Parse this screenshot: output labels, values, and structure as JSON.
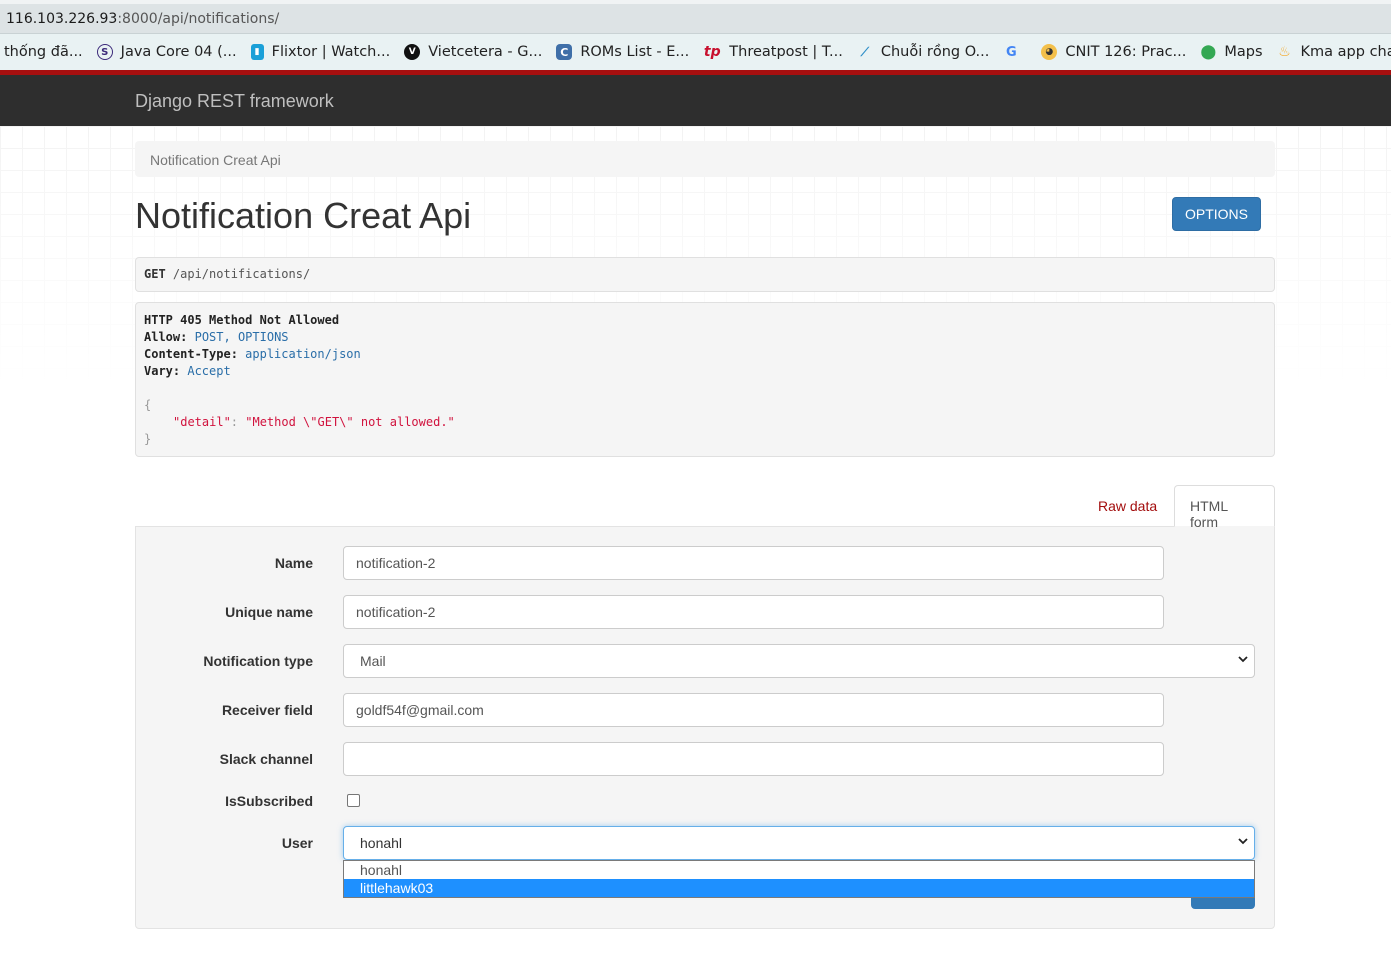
{
  "browser": {
    "url_host": "116.103.226.93",
    "url_rest": ":8000/api/notifications/",
    "bookmarks": [
      {
        "label": "thống đã...",
        "icon": "none"
      },
      {
        "label": "Java Core 04 (...",
        "icon": "s-circle-icon"
      },
      {
        "label": "Flixtor | Watch...",
        "icon": "flixtor-icon"
      },
      {
        "label": "Vietcetera - G...",
        "icon": "v-circle-icon"
      },
      {
        "label": "ROMs List - E...",
        "icon": "c-logo-icon"
      },
      {
        "label": "Threatpost | T...",
        "icon": "tp-icon"
      },
      {
        "label": "Chuỗi rồng O...",
        "icon": "chart-icon"
      },
      {
        "label": "",
        "icon": "google-icon"
      },
      {
        "label": "CNIT 126: Prac...",
        "icon": "penguin-icon"
      },
      {
        "label": "Maps",
        "icon": "maps-pin-icon"
      },
      {
        "label": "Kma app chat...",
        "icon": "firebase-icon"
      }
    ]
  },
  "navbar": {
    "brand": "Django REST framework"
  },
  "breadcrumb": {
    "label": "Notification Creat Api"
  },
  "page": {
    "title": "Notification Creat Api",
    "options_label": "OPTIONS"
  },
  "request": {
    "method": "GET",
    "path_prefix": " /api/notifications/"
  },
  "response": {
    "status": "HTTP 405 Method Not Allowed",
    "allow_key": "Allow:",
    "allow_val": "POST, OPTIONS",
    "ctype_key": "Content-Type:",
    "ctype_val": "application/json",
    "vary_key": "Vary:",
    "vary_val": "Accept",
    "open_brace": "{",
    "detail_key": "\"detail\"",
    "detail_val": "\"Method \\\"GET\\\" not allowed.\"",
    "close_brace": "}"
  },
  "tabs": {
    "raw": "Raw data",
    "html": "HTML form"
  },
  "form": {
    "name_label": "Name",
    "name_value": "notification-2",
    "unique_label": "Unique name",
    "unique_value": "notification-2",
    "type_label": "Notification type",
    "type_value": "Mail",
    "receiver_label": "Receiver field",
    "receiver_value": "goldf54f@gmail.com",
    "slack_label": "Slack channel",
    "slack_value": "",
    "subscribed_label": "IsSubscribed",
    "subscribed_checked": false,
    "user_label": "User",
    "user_value": "honahl",
    "user_options": [
      "honahl",
      "littlehawk03"
    ],
    "user_highlighted": "littlehawk03"
  },
  "colors": {
    "accent": "#337ab7",
    "navbar_bg": "#2e2e2e",
    "highlight": "#1e90ff",
    "tab_link": "#a30d0d"
  }
}
